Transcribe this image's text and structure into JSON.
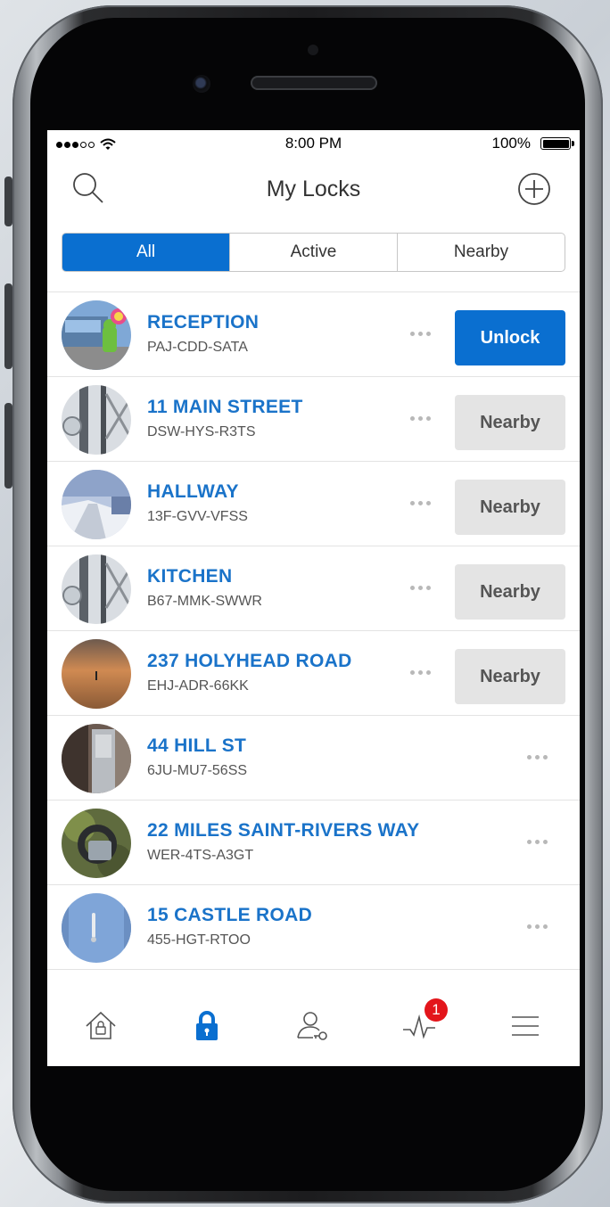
{
  "status_bar": {
    "time": "8:00 PM",
    "battery_percent": "100%"
  },
  "header": {
    "title": "My Locks",
    "left_icon": "search-icon",
    "right_icon": "plus-circle-icon"
  },
  "filter_tabs": [
    {
      "label": "All",
      "selected": true
    },
    {
      "label": "Active",
      "selected": false
    },
    {
      "label": "Nearby",
      "selected": false
    }
  ],
  "locks": [
    {
      "name": "RECEPTION",
      "code": "PAJ-CDD-SATA",
      "action": "Unlock",
      "action_style": "primary"
    },
    {
      "name": "11 MAIN STREET",
      "code": "DSW-HYS-R3TS",
      "action": "Nearby",
      "action_style": "disabled"
    },
    {
      "name": "HALLWAY",
      "code": "13F-GVV-VFSS",
      "action": "Nearby",
      "action_style": "disabled"
    },
    {
      "name": "KITCHEN",
      "code": "B67-MMK-SWWR",
      "action": "Nearby",
      "action_style": "disabled"
    },
    {
      "name": "237 HOLYHEAD ROAD",
      "code": "EHJ-ADR-66KK",
      "action": "Nearby",
      "action_style": "disabled"
    },
    {
      "name": "44 HILL ST",
      "code": "6JU-MU7-56SS",
      "action": "",
      "action_style": "none"
    },
    {
      "name": "22 MILES SAINT-RIVERS WAY",
      "code": "WER-4TS-A3GT",
      "action": "",
      "action_style": "none"
    },
    {
      "name": "15 CASTLE ROAD",
      "code": "455-HGT-RTOO",
      "action": "",
      "action_style": "none"
    }
  ],
  "tab_bar": {
    "items": [
      "home-lock-icon",
      "lock-icon",
      "user-key-icon",
      "activity-icon",
      "menu-icon"
    ],
    "active_index": 1,
    "activity_badge": "1"
  },
  "colors": {
    "accent": "#0a6fd0",
    "link": "#1a73c9",
    "badge": "#e3151b",
    "disabled_button": "#e4e4e4"
  }
}
